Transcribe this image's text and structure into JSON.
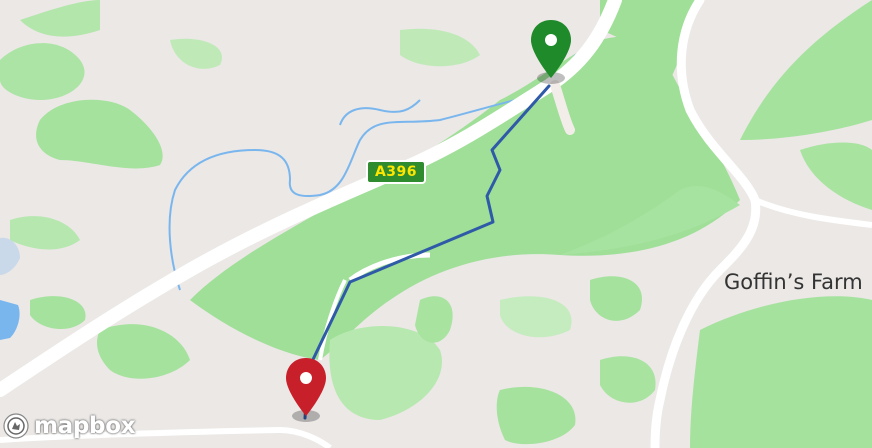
{
  "map": {
    "road_shield": "A396",
    "place_label": "Goffin’s Farm",
    "attribution": "mapbox",
    "start_marker": {
      "icon": "map-pin-icon",
      "color": "#1e8a2a",
      "role": "start"
    },
    "end_marker": {
      "icon": "map-pin-icon",
      "color": "#c8202a",
      "role": "end"
    },
    "route_color": "#2f5aa8",
    "colors": {
      "land": "#ebe8e6",
      "woodland": "#9fdf98",
      "road": "#ffffff",
      "water": "#7ab6ee"
    }
  }
}
